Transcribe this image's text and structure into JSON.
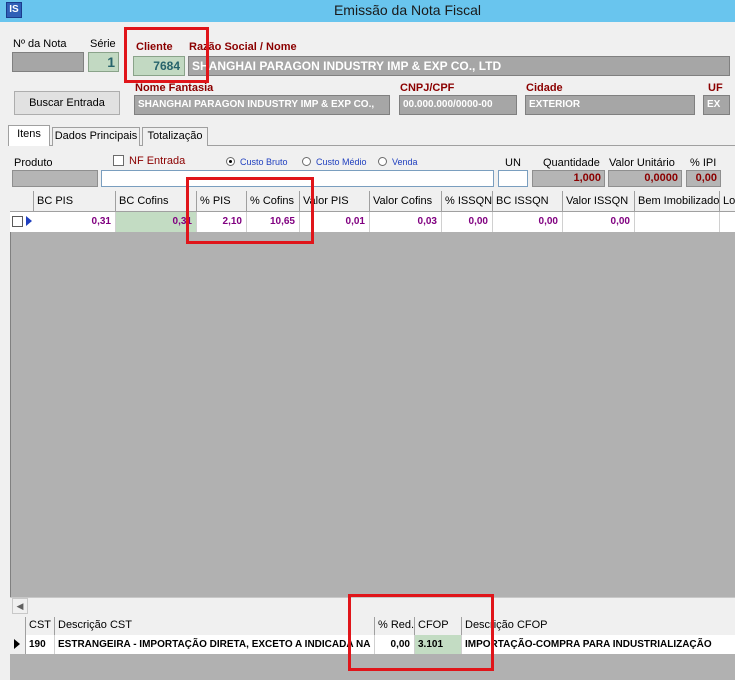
{
  "window": {
    "title": "Emissão da Nota Fiscal",
    "icon": "IS"
  },
  "header": {
    "nf_label": "Nº da Nota",
    "serie_label": "Série",
    "serie_value": "1",
    "cliente_label": "Cliente",
    "cliente_value": "7684",
    "razao_label": "Razão Social / Nome",
    "razao_value": "SHANGHAI PARAGON INDUSTRY IMP & EXP CO., LTD",
    "buscar_button": "Buscar Entrada",
    "fantasia_label": "Nome Fantasia",
    "fantasia_value": "SHANGHAI PARAGON INDUSTRY IMP & EXP CO.,",
    "cnpj_label": "CNPJ/CPF",
    "cnpj_value": "00.000.000/0000-00",
    "cidade_label": "Cidade",
    "cidade_value": "EXTERIOR",
    "uf_label": "UF",
    "uf_value": "EX"
  },
  "tabs": [
    "Itens",
    "Dados Principais",
    "Totalização"
  ],
  "item_form": {
    "produto_label": "Produto",
    "nf_entrada_label": "NF Entrada",
    "radio_options": [
      "Custo Bruto",
      "Custo Médio",
      "Venda"
    ],
    "un_label": "UN",
    "quantidade_label": "Quantidade",
    "quantidade_value": "1,000",
    "valor_unitario_label": "Valor Unitário",
    "valor_unitario_value": "0,0000",
    "ipi_label": "% IPI",
    "ipi_value": "0,00"
  },
  "items_grid": {
    "columns": [
      "BC PIS",
      "BC Cofins",
      "% PIS",
      "% Cofins",
      "Valor PIS",
      "Valor Cofins",
      "% ISSQN",
      "BC ISSQN",
      "Valor ISSQN",
      "Bem Imobilizado",
      "Lo"
    ],
    "row": [
      "0,31",
      "0,31",
      "2,10",
      "10,65",
      "0,01",
      "0,03",
      "0,00",
      "0,00",
      "0,00",
      "",
      ""
    ]
  },
  "cst_grid": {
    "columns": [
      "CST",
      "Descrição CST",
      "% Red.",
      "CFOP",
      "Descrição CFOP"
    ],
    "row": [
      "190",
      "ESTRANGEIRA - IMPORTAÇÃO DIRETA, EXCETO A INDICADA NA",
      "0,00",
      "3.101",
      "IMPORTAÇÃO-COMPRA PARA INDUSTRIALIZAÇÃO"
    ]
  }
}
